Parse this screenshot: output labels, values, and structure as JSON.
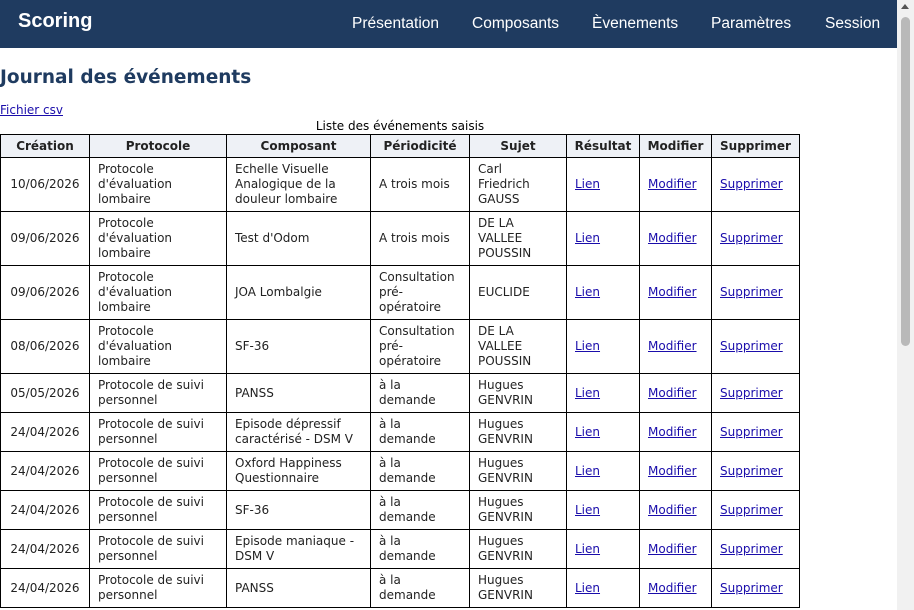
{
  "header": {
    "brand": "Scoring",
    "nav": [
      "Présentation",
      "Composants",
      "Èvenements",
      "Paramètres",
      "Session"
    ]
  },
  "page_title": "Journal des événements",
  "csv_link": "Fichier csv",
  "table": {
    "caption": "Liste des événements saisis",
    "columns": [
      "Création",
      "Protocole",
      "Composant",
      "Périodicité",
      "Sujet",
      "Résultat",
      "Modifier",
      "Supprimer"
    ],
    "rows": [
      {
        "creation": "10/06/2026",
        "protocole": [
          "Protocole",
          "d'évaluation",
          "lombaire"
        ],
        "composant": [
          "Echelle Visuelle",
          "Analogique de la",
          "douleur lombaire"
        ],
        "periodicite": [
          "A trois mois"
        ],
        "sujet": [
          "Carl",
          "Friedrich",
          "GAUSS"
        ],
        "resultat": "Lien",
        "modifier": "Modifier",
        "supprimer": "Supprimer"
      },
      {
        "creation": "09/06/2026",
        "protocole": [
          "Protocole",
          "d'évaluation",
          "lombaire"
        ],
        "composant": [
          "Test d'Odom"
        ],
        "periodicite": [
          "A trois mois"
        ],
        "sujet": [
          "DE LA",
          "VALLEE",
          "POUSSIN"
        ],
        "resultat": "Lien",
        "modifier": "Modifier",
        "supprimer": "Supprimer"
      },
      {
        "creation": "09/06/2026",
        "protocole": [
          "Protocole",
          "d'évaluation",
          "lombaire"
        ],
        "composant": [
          "JOA Lombalgie"
        ],
        "periodicite": [
          "Consultation",
          "pré-",
          "opératoire"
        ],
        "sujet": [
          "EUCLIDE"
        ],
        "resultat": "Lien",
        "modifier": "Modifier",
        "supprimer": "Supprimer"
      },
      {
        "creation": "08/06/2026",
        "protocole": [
          "Protocole",
          "d'évaluation",
          "lombaire"
        ],
        "composant": [
          "SF-36"
        ],
        "periodicite": [
          "Consultation",
          "pré-",
          "opératoire"
        ],
        "sujet": [
          "DE LA",
          "VALLEE",
          "POUSSIN"
        ],
        "resultat": "Lien",
        "modifier": "Modifier",
        "supprimer": "Supprimer"
      },
      {
        "creation": "05/05/2026",
        "protocole": [
          "Protocole de suivi",
          "personnel"
        ],
        "composant": [
          "PANSS"
        ],
        "periodicite": [
          "à la",
          "demande"
        ],
        "sujet": [
          "Hugues",
          "GENVRIN"
        ],
        "resultat": "Lien",
        "modifier": "Modifier",
        "supprimer": "Supprimer"
      },
      {
        "creation": "24/04/2026",
        "protocole": [
          "Protocole de suivi",
          "personnel"
        ],
        "composant": [
          "Episode dépressif",
          "caractérisé - DSM V"
        ],
        "periodicite": [
          "à la",
          "demande"
        ],
        "sujet": [
          "Hugues",
          "GENVRIN"
        ],
        "resultat": "Lien",
        "modifier": "Modifier",
        "supprimer": "Supprimer"
      },
      {
        "creation": "24/04/2026",
        "protocole": [
          "Protocole de suivi",
          "personnel"
        ],
        "composant": [
          "Oxford Happiness",
          "Questionnaire"
        ],
        "periodicite": [
          "à la",
          "demande"
        ],
        "sujet": [
          "Hugues",
          "GENVRIN"
        ],
        "resultat": "Lien",
        "modifier": "Modifier",
        "supprimer": "Supprimer"
      },
      {
        "creation": "24/04/2026",
        "protocole": [
          "Protocole de suivi",
          "personnel"
        ],
        "composant": [
          "SF-36"
        ],
        "periodicite": [
          "à la",
          "demande"
        ],
        "sujet": [
          "Hugues",
          "GENVRIN"
        ],
        "resultat": "Lien",
        "modifier": "Modifier",
        "supprimer": "Supprimer"
      },
      {
        "creation": "24/04/2026",
        "protocole": [
          "Protocole de suivi",
          "personnel"
        ],
        "composant": [
          "Episode maniaque -",
          "DSM V"
        ],
        "periodicite": [
          "à la",
          "demande"
        ],
        "sujet": [
          "Hugues",
          "GENVRIN"
        ],
        "resultat": "Lien",
        "modifier": "Modifier",
        "supprimer": "Supprimer"
      },
      {
        "creation": "24/04/2026",
        "protocole": [
          "Protocole de suivi",
          "personnel"
        ],
        "composant": [
          "PANSS"
        ],
        "periodicite": [
          "à la",
          "demande"
        ],
        "sujet": [
          "Hugues",
          "GENVRIN"
        ],
        "resultat": "Lien",
        "modifier": "Modifier",
        "supprimer": "Supprimer"
      }
    ]
  },
  "colors": {
    "header_bg": "#1f3b60",
    "title": "#1f3b60",
    "link": "#1a0dab"
  }
}
